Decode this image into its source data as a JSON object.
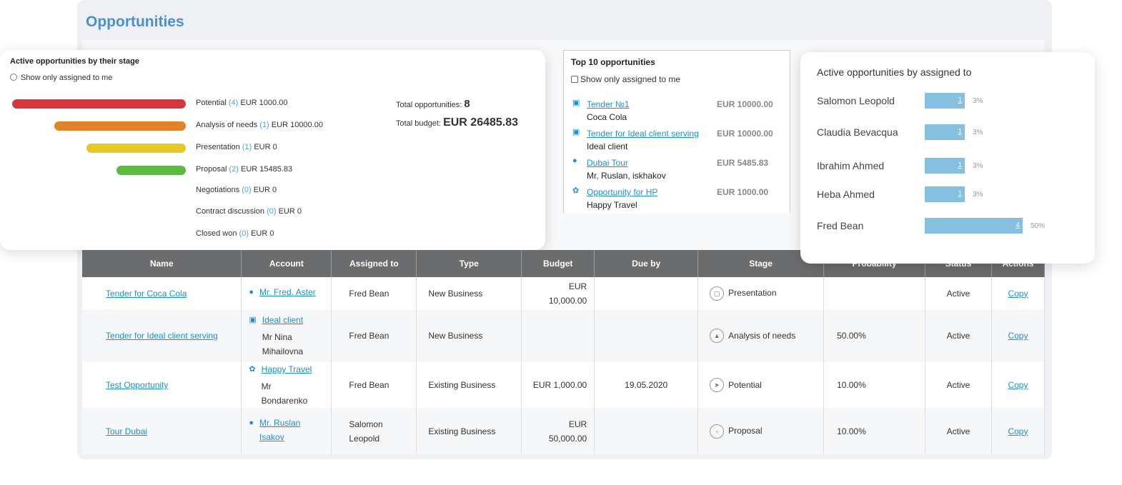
{
  "page": {
    "title": "Opportunities"
  },
  "stage_widget": {
    "title": "Active opportunities by their stage",
    "filter_label": "Show only assigned to me",
    "stages": [
      {
        "name": "Potential",
        "count": "(4)",
        "amount": "EUR 1000.00",
        "color": "#d9363b"
      },
      {
        "name": "Analysis of needs",
        "count": "(1)",
        "amount": "EUR 10000.00",
        "color": "#e0832b"
      },
      {
        "name": "Presentation",
        "count": "(1)",
        "amount": "EUR 0",
        "color": "#e8c824"
      },
      {
        "name": "Proposal",
        "count": "(2)",
        "amount": "EUR 15485.83",
        "color": "#5cb942"
      },
      {
        "name": "Negotiations",
        "count": "(0)",
        "amount": "EUR 0"
      },
      {
        "name": "Contract discussion",
        "count": "(0)",
        "amount": "EUR 0"
      },
      {
        "name": "Closed won",
        "count": "(0)",
        "amount": "EUR 0"
      }
    ],
    "total_opportunities_label": "Total opportunities:",
    "total_opportunities": "8",
    "total_budget_label": "Total budget:",
    "total_budget": "EUR 26485.83"
  },
  "top10": {
    "title": "Top 10 opportunities",
    "filter_label": "Show only assigned to me",
    "items": [
      {
        "icon": "briefcase-icon",
        "name": "Tender №1",
        "account": "Coca Cola",
        "amount": "EUR 10000.00"
      },
      {
        "icon": "briefcase-icon",
        "name": "Tender for Ideal client serving",
        "account": "Ideal client",
        "amount": "EUR 10000.00"
      },
      {
        "icon": "person-icon",
        "name": "Dubai Tour",
        "account": "Mr, Ruslan, iskhakov",
        "amount": "EUR 5485.83"
      },
      {
        "icon": "group-icon",
        "name": "Opportunity for HP",
        "account": "Happy Travel",
        "amount": "EUR 1000.00"
      }
    ]
  },
  "assigned_widget": {
    "title": "Active opportunities by assigned to",
    "rows": [
      {
        "name": "Salomon Leopold",
        "count": "1",
        "percent": "3%"
      },
      {
        "name": "Claudia Bevacqua",
        "count": "1",
        "percent": "3%"
      },
      {
        "name": "Ibrahim Ahmed",
        "count": "1",
        "percent": "3%"
      },
      {
        "name": "Heba Ahmed",
        "count": "1",
        "percent": "3%"
      },
      {
        "name": "Fred Bean",
        "count": "4",
        "percent": "50%"
      }
    ]
  },
  "table": {
    "headers": [
      "Name",
      "Account",
      "Assigned to",
      "Type",
      "Budget",
      "Due by",
      "Stage",
      "Probability",
      "Status",
      "Actions"
    ],
    "rows": [
      {
        "name": "Tender for Coca Cola",
        "account_icon": "person-icon",
        "account": "Mr. Fred. Aster",
        "contact": "",
        "assigned": "Fred Bean",
        "type": "New Business",
        "budget": "EUR 10,000.00",
        "due": "",
        "stage_icon": "presentation-icon",
        "stage": "Presentation",
        "probability": "",
        "status": "Active",
        "action": "Copy"
      },
      {
        "name": "Tender for Ideal client serving",
        "account_icon": "briefcase-icon",
        "account": "Ideal client",
        "contact": "Mr Nina Mihailovna",
        "assigned": "Fred Bean",
        "type": "New Business",
        "budget": "",
        "due": "",
        "stage_icon": "analysis-icon",
        "stage": "Analysis of needs",
        "probability": "50.00%",
        "status": "Active",
        "action": "Copy"
      },
      {
        "name": "Test Opportunity",
        "account_icon": "group-icon",
        "account": "Happy Travel",
        "contact": "Mr Bondarenko",
        "assigned": "Fred Bean",
        "type": "Existing Business",
        "budget": "EUR 1,000.00",
        "due": "19.05.2020",
        "stage_icon": "potential-icon",
        "stage": "Potential",
        "probability": "10.00%",
        "status": "Active",
        "action": "Copy"
      },
      {
        "name": "Tour Dubai",
        "account_icon": "person-icon",
        "account": "Mr. Ruslan Isakov",
        "contact": "",
        "assigned": "Salomon Leopold",
        "type": "Existing Business",
        "budget": "EUR 50,000.00",
        "due": "",
        "stage_icon": "proposal-icon",
        "stage": "Proposal",
        "probability": "10.00%",
        "status": "Active",
        "action": "Copy"
      }
    ]
  }
}
